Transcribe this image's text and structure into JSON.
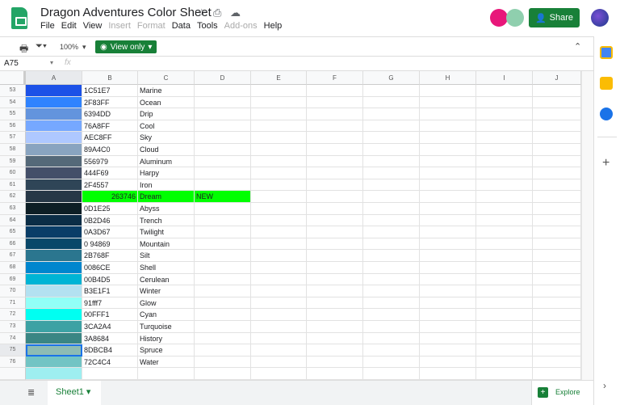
{
  "header": {
    "title": "Dragon Adventures Color Sheet",
    "menu": [
      "File",
      "Edit",
      "View",
      "Insert",
      "Format",
      "Data",
      "Tools",
      "Add-ons",
      "Help"
    ],
    "menu_disabled": [
      false,
      false,
      false,
      true,
      true,
      false,
      false,
      true,
      false
    ],
    "share_label": "Share"
  },
  "toolbar": {
    "zoom": "100%",
    "view_only": "View only"
  },
  "formula": {
    "cell_ref": "A75",
    "fx": "fx"
  },
  "columns": [
    "A",
    "B",
    "C",
    "D",
    "E",
    "F",
    "G",
    "H",
    "I",
    "J"
  ],
  "rows": [
    {
      "n": "53",
      "color": "#1C51E7",
      "b": "1C51E7",
      "c": "Marine"
    },
    {
      "n": "54",
      "color": "#2F83FF",
      "b": "2F83FF",
      "c": "Ocean"
    },
    {
      "n": "55",
      "color": "#6394DD",
      "b": "6394DD",
      "c": "Drip"
    },
    {
      "n": "56",
      "color": "#76A8FF",
      "b": "76A8FF",
      "c": "Cool"
    },
    {
      "n": "57",
      "color": "#AEC8FF",
      "b": "AEC8FF",
      "c": "Sky"
    },
    {
      "n": "58",
      "color": "#89A4C0",
      "b": "89A4C0",
      "c": "Cloud"
    },
    {
      "n": "59",
      "color": "#556979",
      "b": "556979",
      "c": "Aluminum"
    },
    {
      "n": "60",
      "color": "#444F69",
      "b": "444F69",
      "c": "Harpy"
    },
    {
      "n": "61",
      "color": "#2F4557",
      "b": "2F4557",
      "c": "Iron"
    },
    {
      "n": "62",
      "color": "#263746",
      "b": "263746",
      "c": "Dream",
      "d": "NEW",
      "highlight": "#00ff00"
    },
    {
      "n": "63",
      "color": "#0D1E25",
      "b": "0D1E25",
      "c": "Abyss"
    },
    {
      "n": "64",
      "color": "#0B2D46",
      "b": "0B2D46",
      "c": "Trench"
    },
    {
      "n": "65",
      "color": "#0A3D67",
      "b": "0A3D67",
      "c": "Twilight"
    },
    {
      "n": "66",
      "color": "#094869",
      "b": "0 94869",
      "c": "Mountain"
    },
    {
      "n": "67",
      "color": "#2B768F",
      "b": "2B768F",
      "c": "Silt"
    },
    {
      "n": "68",
      "color": "#0086CE",
      "b": "0086CE",
      "c": "Shell"
    },
    {
      "n": "69",
      "color": "#00B4D5",
      "b": "00B4D5",
      "c": "Cerulean"
    },
    {
      "n": "70",
      "color": "#B3E1F1",
      "b": "B3E1F1",
      "c": "Winter"
    },
    {
      "n": "71",
      "color": "#91fff7",
      "b": "91fff7",
      "c": "Glow"
    },
    {
      "n": "72",
      "color": "#00FFF1",
      "b": "00FFF1",
      "c": "Cyan"
    },
    {
      "n": "73",
      "color": "#3CA2A4",
      "b": "3CA2A4",
      "c": "Turquoise"
    },
    {
      "n": "74",
      "color": "#3A8684",
      "b": "3A8684",
      "c": "History"
    },
    {
      "n": "75",
      "color": "#8DBCB4",
      "b": "8DBCB4",
      "c": "Spruce",
      "selected": true
    },
    {
      "n": "76",
      "color": "#72C4C4",
      "b": "72C4C4",
      "c": "Water"
    },
    {
      "n": "",
      "color": "#9EEEF0",
      "b": "",
      "c": ""
    }
  ],
  "bottom": {
    "sheet": "Sheet1",
    "explore": "Explore"
  },
  "colors": {
    "accent": "#188038"
  }
}
